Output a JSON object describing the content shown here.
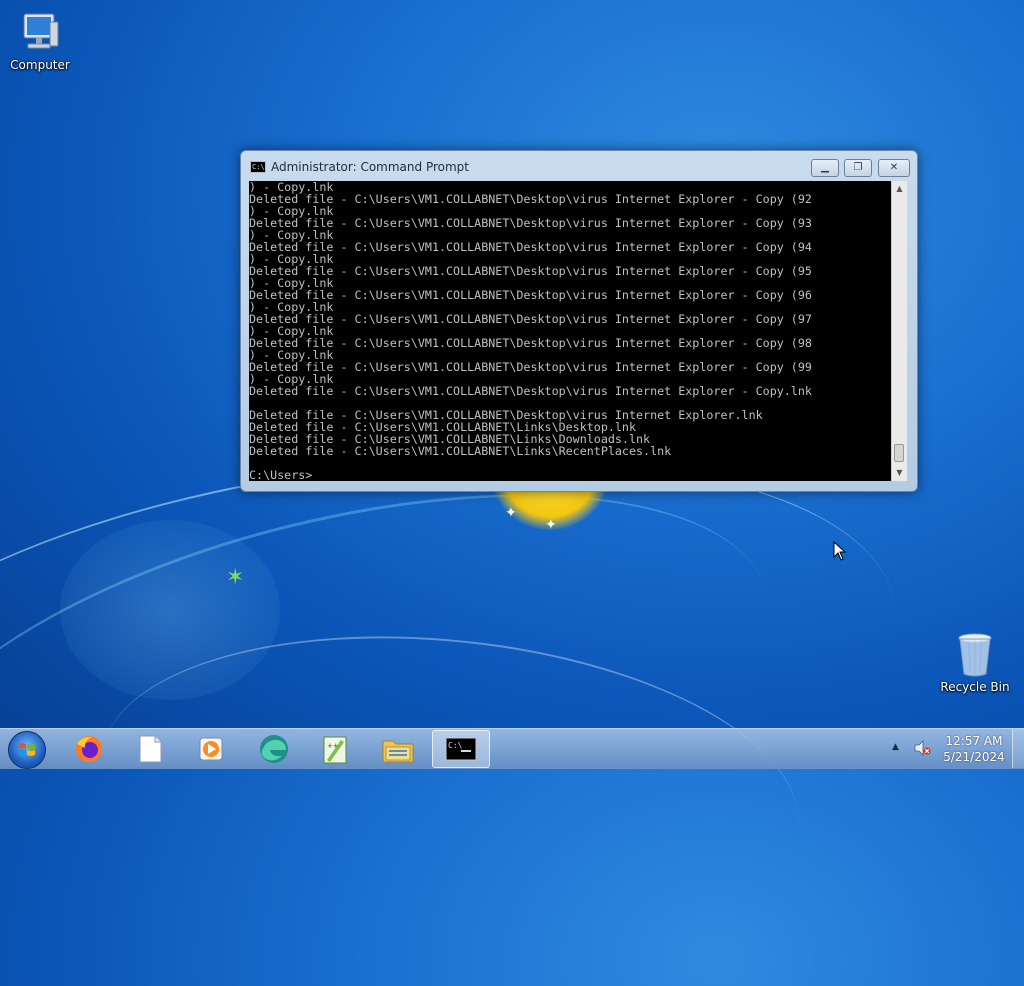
{
  "desktop": {
    "icons": [
      {
        "label": "Computer",
        "icon": "computer-icon"
      },
      {
        "label": "Recycle Bin",
        "icon": "recycle-bin-icon"
      }
    ]
  },
  "window": {
    "title": "Administrator:  Command Prompt",
    "icon": "cmd-icon",
    "buttons": {
      "minimize": "minimize",
      "maximize": "maximize",
      "close": "close"
    },
    "console_text": ") - Copy.lnk\nDeleted file - C:\\Users\\VM1.COLLABNET\\Desktop\\virus Internet Explorer - Copy (92\n) - Copy.lnk\nDeleted file - C:\\Users\\VM1.COLLABNET\\Desktop\\virus Internet Explorer - Copy (93\n) - Copy.lnk\nDeleted file - C:\\Users\\VM1.COLLABNET\\Desktop\\virus Internet Explorer - Copy (94\n) - Copy.lnk\nDeleted file - C:\\Users\\VM1.COLLABNET\\Desktop\\virus Internet Explorer - Copy (95\n) - Copy.lnk\nDeleted file - C:\\Users\\VM1.COLLABNET\\Desktop\\virus Internet Explorer - Copy (96\n) - Copy.lnk\nDeleted file - C:\\Users\\VM1.COLLABNET\\Desktop\\virus Internet Explorer - Copy (97\n) - Copy.lnk\nDeleted file - C:\\Users\\VM1.COLLABNET\\Desktop\\virus Internet Explorer - Copy (98\n) - Copy.lnk\nDeleted file - C:\\Users\\VM1.COLLABNET\\Desktop\\virus Internet Explorer - Copy (99\n) - Copy.lnk\nDeleted file - C:\\Users\\VM1.COLLABNET\\Desktop\\virus Internet Explorer - Copy.lnk\n\nDeleted file - C:\\Users\\VM1.COLLABNET\\Desktop\\virus Internet Explorer.lnk\nDeleted file - C:\\Users\\VM1.COLLABNET\\Links\\Desktop.lnk\nDeleted file - C:\\Users\\VM1.COLLABNET\\Links\\Downloads.lnk\nDeleted file - C:\\Users\\VM1.COLLABNET\\Links\\RecentPlaces.lnk\n\nC:\\Users>",
    "scrollbar": {
      "position": 0.95
    }
  },
  "taskbar": {
    "start_icon": "windows-start-icon",
    "items": [
      {
        "icon": "firefox-icon",
        "active": false
      },
      {
        "icon": "blank-document-icon",
        "active": false
      },
      {
        "icon": "media-player-icon",
        "active": false
      },
      {
        "icon": "edge-like-browser-icon",
        "active": false
      },
      {
        "icon": "notepad-plus-plus-icon",
        "active": false
      },
      {
        "icon": "file-explorer-icon",
        "active": false
      },
      {
        "icon": "command-prompt-icon",
        "active": true
      }
    ],
    "tray": {
      "chevron_icon": "show-hidden-icons-icon",
      "volume_icon": "volume-muted-icon",
      "time": "12:57 AM",
      "date": "5/21/2024"
    }
  },
  "colors": {
    "desktop_bg": "#0b56b8",
    "console_bg": "#000000",
    "console_fg": "#c0c0c0",
    "window_frame": "#c9dbee"
  }
}
